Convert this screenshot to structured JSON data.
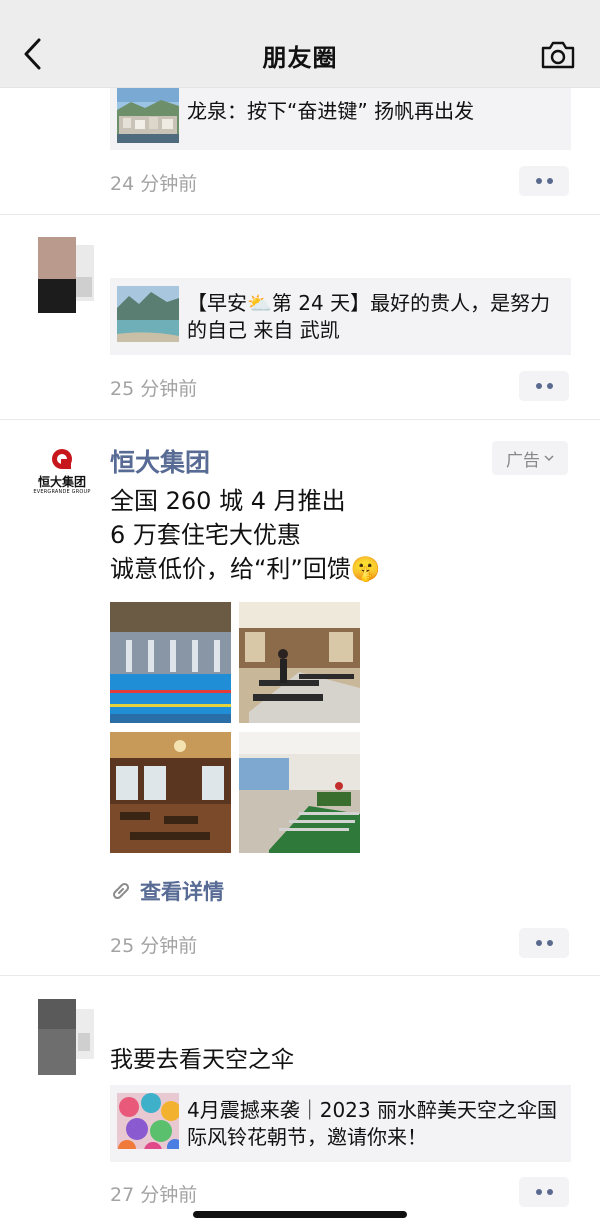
{
  "nav": {
    "title": "朋友圈",
    "back_icon": "chevron-left-icon",
    "camera_icon": "camera-icon"
  },
  "posts": [
    {
      "link_title": "龙泉：按下“奋进键” 扬帆再出发",
      "time": "24 分钟前"
    },
    {
      "link_title": "【早安⛅第 24 天】最好的贵人，是努力的自己 来自 武凯",
      "time": "25 分钟前"
    },
    {
      "is_ad": true,
      "brand_logo_text": "恒大集团",
      "brand_logo_subtext": "EVERGRANDE GROUP",
      "name": "恒大集团",
      "badge": "广告",
      "text_lines": [
        "全国 260 城 4 月推出",
        "6 万套住宅大优惠",
        "诚意低价，给“利”回馈🤫"
      ],
      "images": [
        "indoor-pool",
        "gym-treadmills",
        "dining-hall",
        "game-room-foosball"
      ],
      "detail_link": "查看详情",
      "time": "25 分钟前"
    },
    {
      "text": "我要去看天空之伞",
      "link_title": "4月震撼来袭｜2023 丽水醉美天空之伞国际风铃花朝节，邀请你来！",
      "time": "27 分钟前"
    }
  ],
  "colors": {
    "link_blue": "#576b95",
    "time_gray": "#a3a3a3",
    "card_bg": "#f3f3f5",
    "nav_bg": "#ededed",
    "brand_red": "#c8161d"
  }
}
